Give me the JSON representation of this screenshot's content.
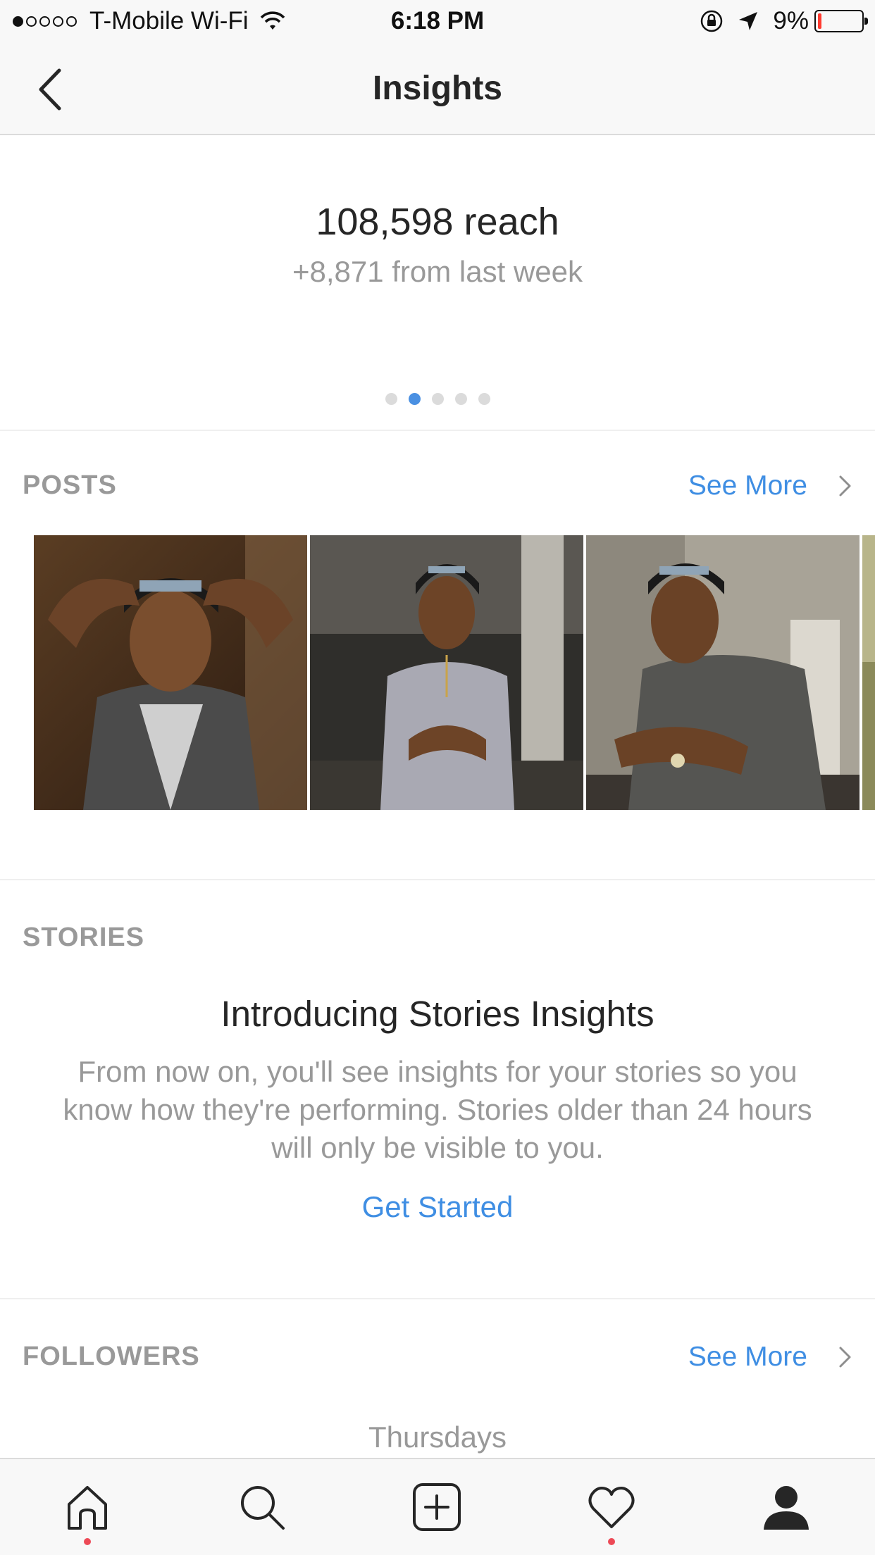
{
  "status_bar": {
    "carrier": "T-Mobile Wi-Fi",
    "time": "6:18 PM",
    "battery_percent": "9%",
    "battery_level": 0.09,
    "signal_bars": 1
  },
  "nav": {
    "title": "Insights"
  },
  "reach": {
    "value": "108,598 reach",
    "change": "+8,871 from last week",
    "page_count": 5,
    "active_page": 2
  },
  "posts": {
    "label": "POSTS",
    "see_more": "See More",
    "thumbnails": [
      "post-1",
      "post-2",
      "post-3",
      "post-4"
    ]
  },
  "stories": {
    "label": "STORIES",
    "title": "Introducing Stories Insights",
    "description": "From now on, you'll see insights for your stories so you know how they're performing. Stories older than 24 hours will only be visible to you.",
    "cta": "Get Started"
  },
  "followers": {
    "label": "FOLLOWERS",
    "see_more": "See More",
    "top_day": "Thursdays"
  },
  "tab_bar": {
    "tabs": [
      {
        "icon": "home-icon",
        "badge": true
      },
      {
        "icon": "search-icon",
        "badge": false
      },
      {
        "icon": "add-post-icon",
        "badge": false
      },
      {
        "icon": "heart-icon",
        "badge": true
      },
      {
        "icon": "profile-icon",
        "badge": false
      }
    ]
  },
  "colors": {
    "accent": "#3f8ee3",
    "badge": "#ed4956",
    "battery_low": "#ff3b30"
  }
}
